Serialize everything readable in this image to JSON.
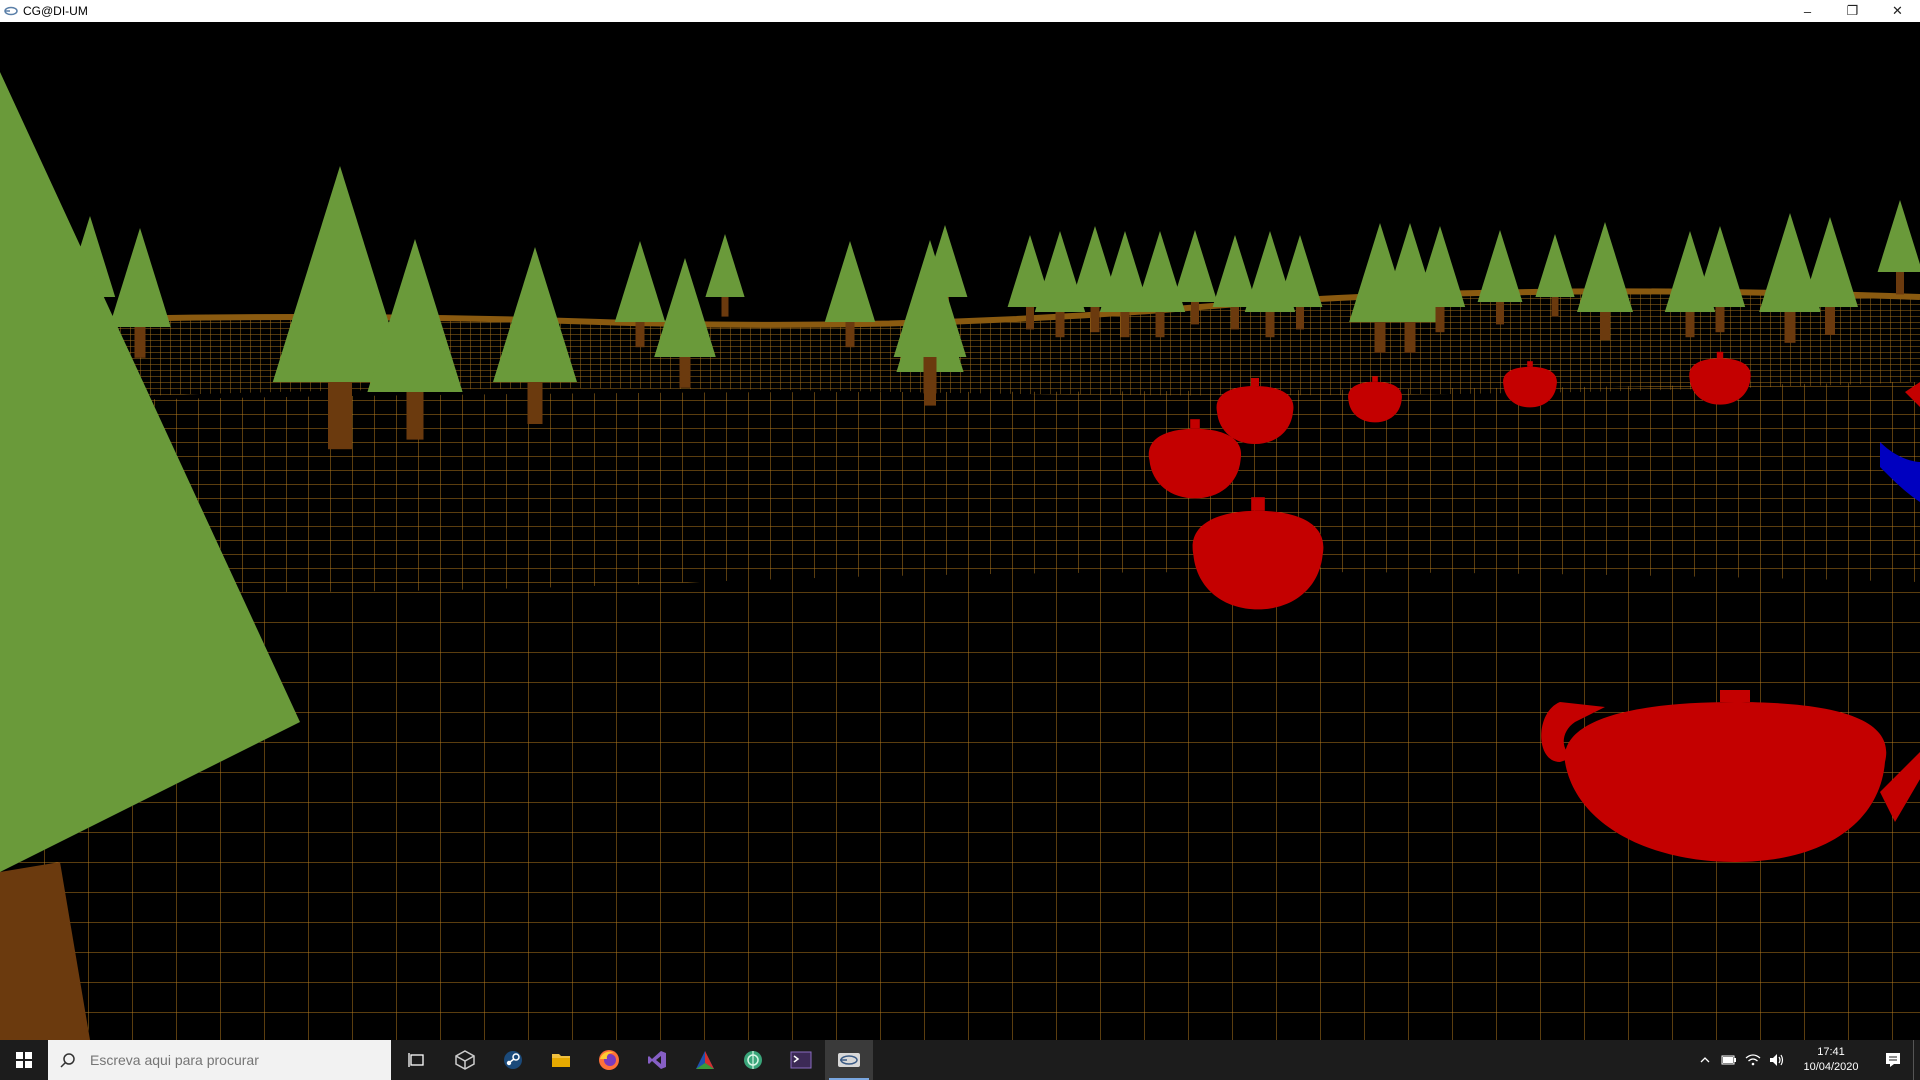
{
  "window": {
    "title": "CG@DI-UM",
    "controls": {
      "minimize": "–",
      "maximize": "❐",
      "close": "✕"
    }
  },
  "scene": {
    "sky_color": "#000000",
    "terrain_wire_color": "#b37a1e",
    "tree_color": "#6a9a3a",
    "trunk_color": "#6b3a0e",
    "teapot_color": "#c40000",
    "teapot_alt_color": "#0000c0"
  },
  "taskbar": {
    "search_placeholder": "Escreva aqui para procurar",
    "apps": [
      {
        "icon": "task-view-icon",
        "active": false
      },
      {
        "icon": "virtualbox-icon",
        "active": false
      },
      {
        "icon": "steam-icon",
        "active": false
      },
      {
        "icon": "file-explorer-icon",
        "active": false
      },
      {
        "icon": "firefox-icon",
        "active": false
      },
      {
        "icon": "visual-studio-icon",
        "active": false
      },
      {
        "icon": "cmake-icon",
        "active": false
      },
      {
        "icon": "globe-app-icon",
        "active": false
      },
      {
        "icon": "terminal-icon",
        "active": false
      },
      {
        "icon": "cg-app-icon",
        "active": true
      }
    ],
    "clock": {
      "time": "17:41",
      "date": "10/04/2020"
    }
  }
}
